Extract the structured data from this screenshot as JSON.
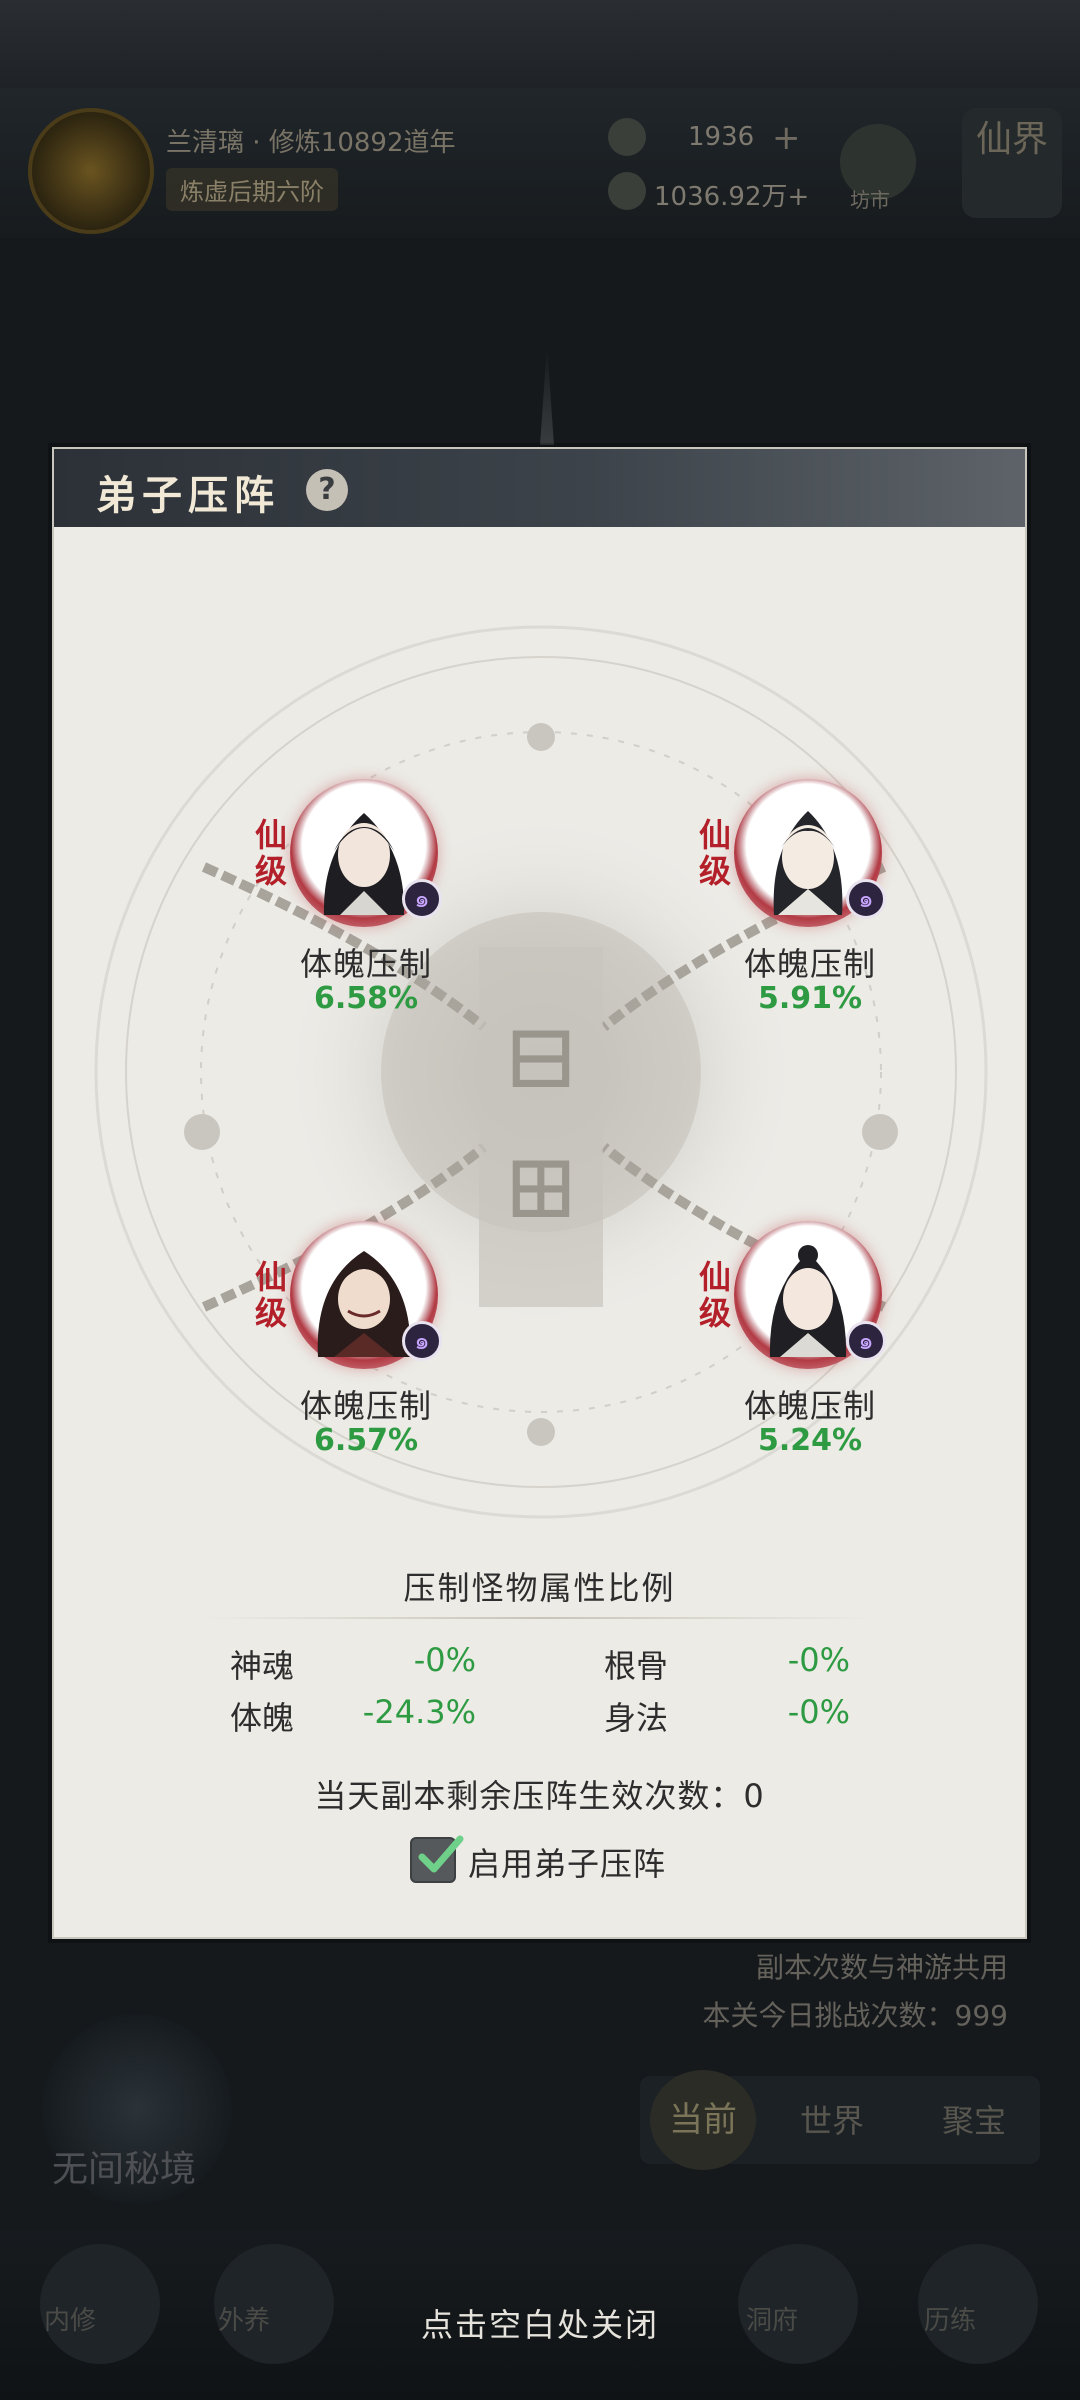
{
  "background": {
    "player_name": "兰清璃 · 修炼10892道年",
    "realm": "炼虚后期六阶",
    "currency_1": "1936",
    "currency_2": "1036.92万+",
    "market_label": "坊市",
    "realm_button_label": "仙界",
    "shared_note": "副本次数与神游共用",
    "daily_challenges": "本关今日挑战次数：999",
    "secret_label": "无间秘境",
    "tabs": [
      "当前",
      "世界",
      "聚宝"
    ],
    "bottom_nav": [
      "内修",
      "外养",
      "洞府",
      "历练"
    ]
  },
  "panel": {
    "title": "弟子压阵",
    "help_glyph": "?",
    "disciples": [
      {
        "rank": "仙\n级",
        "skill": "体魄压制",
        "percent": "6.58%"
      },
      {
        "rank": "仙\n级",
        "skill": "体魄压制",
        "percent": "5.91%"
      },
      {
        "rank": "仙\n级",
        "skill": "体魄压制",
        "percent": "6.57%"
      },
      {
        "rank": "仙\n级",
        "skill": "体魄压制",
        "percent": "5.24%"
      }
    ],
    "ratio_title": "压制怪物属性比例",
    "stats": [
      {
        "label": "神魂",
        "value": "-0%"
      },
      {
        "label": "根骨",
        "value": "-0%"
      },
      {
        "label": "体魄",
        "value": "-24.3%"
      },
      {
        "label": "身法",
        "value": "-0%"
      }
    ],
    "remaining_text": "当天副本剩余压阵生效次数：0",
    "enable_label": "启用弟子压阵",
    "enabled": true
  },
  "close_hint": "点击空白处关闭",
  "colors": {
    "accent_green": "#2e9b43",
    "rank_red": "#b3202a",
    "header_dark": "#2c3137",
    "panel_bg": "#ecebe6"
  }
}
